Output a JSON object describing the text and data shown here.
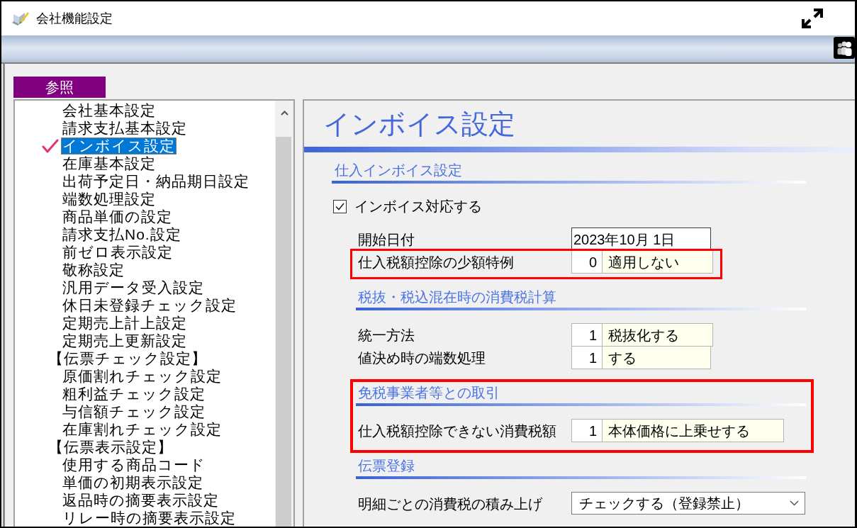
{
  "window": {
    "title": "会社機能設定"
  },
  "reference_tab": {
    "label": "参照"
  },
  "menu": {
    "items": [
      {
        "label": "会社基本設定",
        "selected": false
      },
      {
        "label": "請求支払基本設定",
        "selected": false
      },
      {
        "label": "インボイス設定",
        "selected": true
      },
      {
        "label": "在庫基本設定",
        "selected": false
      },
      {
        "label": "出荷予定日・納品期日設定",
        "selected": false
      },
      {
        "label": "端数処理設定",
        "selected": false
      },
      {
        "label": "商品単価の設定",
        "selected": false
      },
      {
        "label": "請求支払No.設定",
        "selected": false
      },
      {
        "label": "前ゼロ表示設定",
        "selected": false
      },
      {
        "label": "敬称設定",
        "selected": false
      },
      {
        "label": "汎用データ受入設定",
        "selected": false
      },
      {
        "label": "休日未登録チェック設定",
        "selected": false
      },
      {
        "label": "定期売上計上設定",
        "selected": false
      },
      {
        "label": "定期売上更新設定",
        "selected": false
      },
      {
        "label": "【伝票チェック設定】",
        "selected": false,
        "children": [
          {
            "label": "原価割れチェック設定",
            "selected": false
          },
          {
            "label": "粗利益チェック設定",
            "selected": false
          },
          {
            "label": "与信額チェック設定",
            "selected": false
          },
          {
            "label": "在庫割れチェック設定",
            "selected": false
          }
        ]
      },
      {
        "label": "【伝票表示設定】",
        "selected": false,
        "children": [
          {
            "label": "使用する商品コード",
            "selected": false
          },
          {
            "label": "単価の初期表示設定",
            "selected": false
          },
          {
            "label": "返品時の摘要表示設定",
            "selected": false
          },
          {
            "label": "リレー時の摘要表示設定",
            "selected": false
          }
        ]
      }
    ]
  },
  "panel": {
    "title": "インボイス設定",
    "sections": [
      {
        "heading": "仕入インボイス設定",
        "highlighted": false,
        "items": [
          {
            "kind": "checkbox",
            "label": "インボイス対応する",
            "checked": true
          },
          {
            "kind": "date",
            "label": "開始日付",
            "value": "2023年10月 1日",
            "highlighted": false
          },
          {
            "kind": "code",
            "label": "仕入税額控除の少額特例",
            "code": "0",
            "value": "適用しない",
            "highlighted": true
          },
          {
            "kind": "section",
            "heading": "税抜・税込混在時の消費税計算",
            "highlighted": false,
            "items": [
              {
                "kind": "code",
                "label": "統一方法",
                "code": "1",
                "value": "税抜化する",
                "highlighted": false
              },
              {
                "kind": "code",
                "label": "値決め時の端数処理",
                "code": "1",
                "value": "する",
                "highlighted": false
              }
            ]
          },
          {
            "kind": "section",
            "heading": "免税事業者等との取引",
            "highlighted": true,
            "items": [
              {
                "kind": "code",
                "label": "仕入税額控除できない消費税額",
                "code": "1",
                "value": "本体価格に上乗せする",
                "highlighted": false
              }
            ]
          },
          {
            "kind": "section",
            "heading": "伝票登録",
            "highlighted": false,
            "items": [
              {
                "kind": "select",
                "label": "明細ごとの消費税の積み上げ",
                "value": "チェックする（登録禁止）",
                "highlighted": false
              }
            ]
          }
        ]
      }
    ]
  }
}
